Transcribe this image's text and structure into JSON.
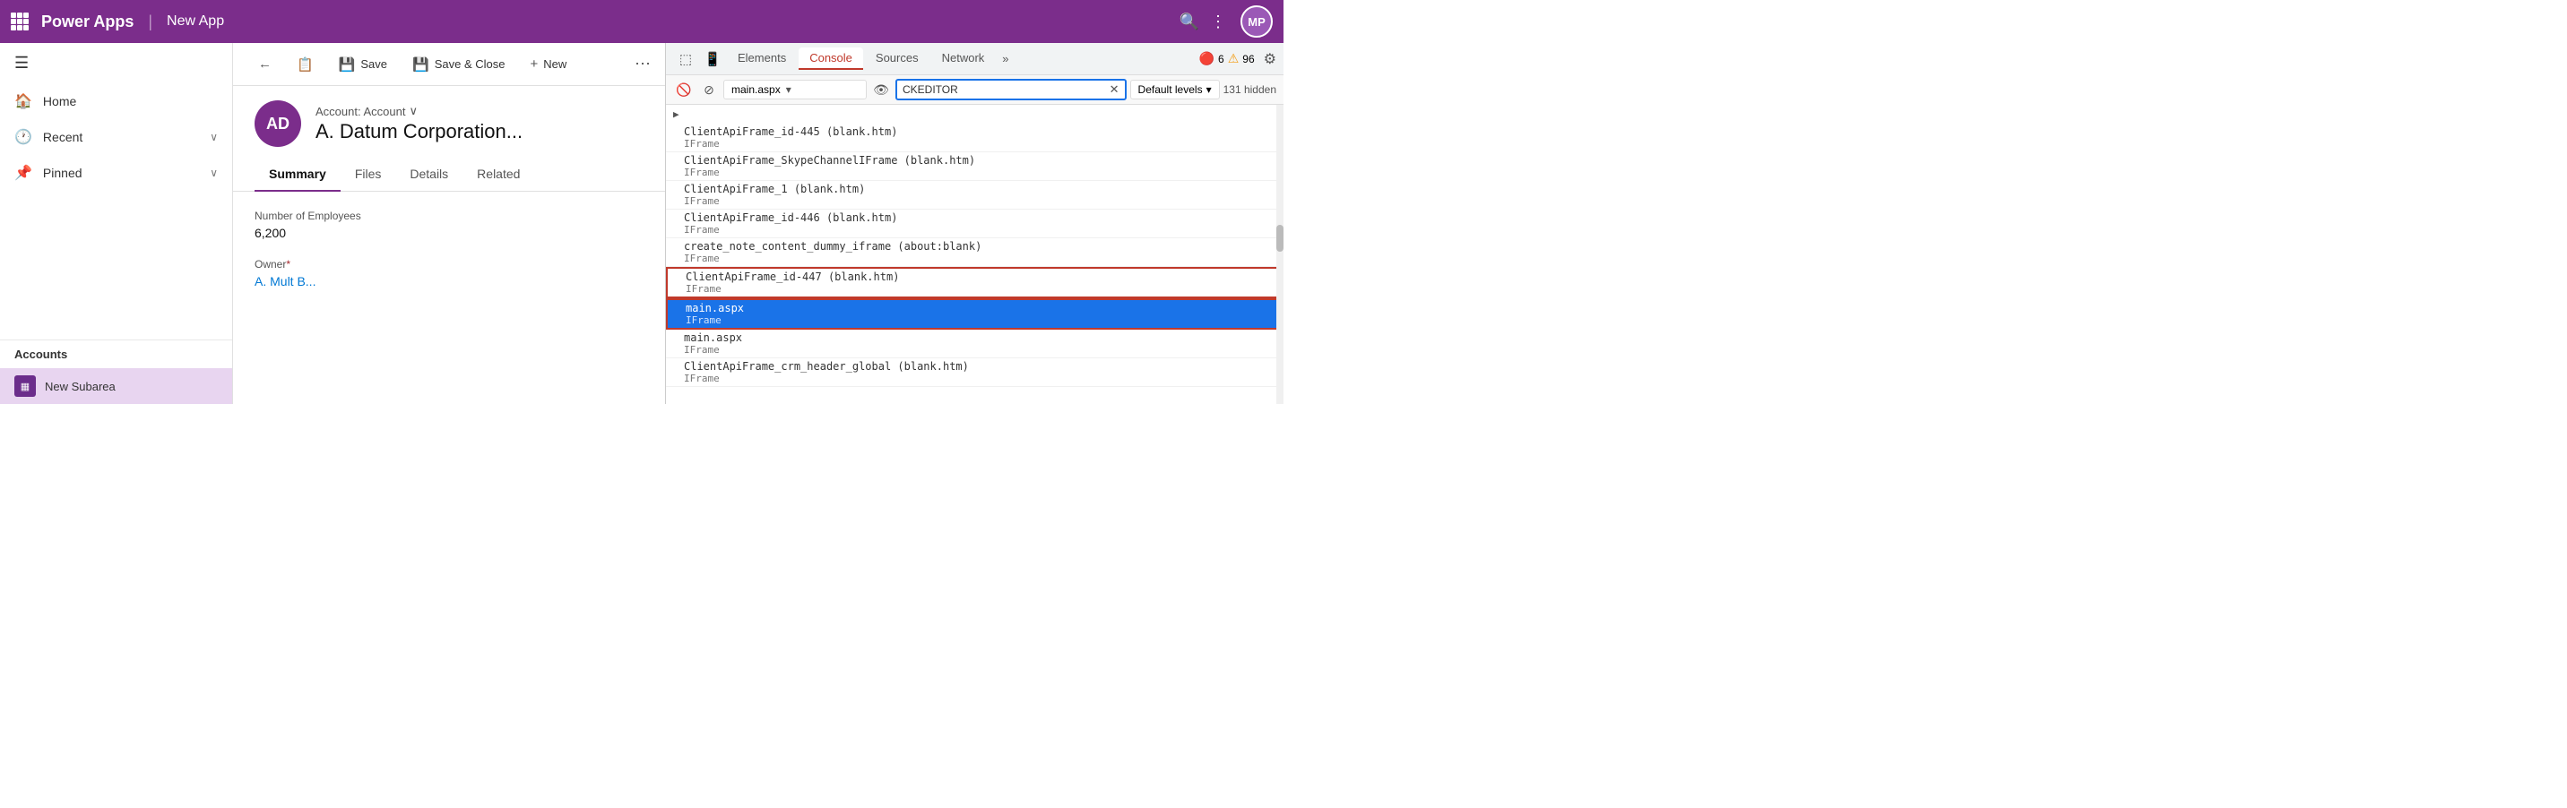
{
  "topbar": {
    "app_icon": "waffle",
    "title": "Power Apps",
    "divider": "|",
    "app_name": "New App",
    "search_icon": "🔍",
    "more_icon": "⋮",
    "avatar_initials": "MP"
  },
  "sidebar": {
    "toggle_icon": "☰",
    "nav_items": [
      {
        "id": "home",
        "icon": "🏠",
        "label": "Home",
        "has_chevron": false
      },
      {
        "id": "recent",
        "icon": "🕐",
        "label": "Recent",
        "has_chevron": true
      },
      {
        "id": "pinned",
        "icon": "📌",
        "label": "Pinned",
        "has_chevron": true
      }
    ],
    "section_label": "Accounts",
    "subarea_label": "New Subarea"
  },
  "commandbar": {
    "back_icon": "←",
    "form_icon": "📋",
    "save_label": "Save",
    "save_close_icon": "💾",
    "save_close_label": "Save & Close",
    "new_icon": "+",
    "new_label": "New",
    "more_icon": "⋯"
  },
  "record": {
    "avatar_initials": "AD",
    "type_label": "Account: Account",
    "chevron_icon": "∨",
    "name": "A. Datum Corporation...",
    "tabs": [
      {
        "id": "summary",
        "label": "Summary",
        "active": true
      },
      {
        "id": "files",
        "label": "Files",
        "active": false
      },
      {
        "id": "details",
        "label": "Details",
        "active": false
      },
      {
        "id": "related",
        "label": "Related",
        "active": false
      }
    ],
    "fields": [
      {
        "label": "Number of Employees",
        "value": "6,200",
        "required": false,
        "is_link": false
      },
      {
        "label": "Owner",
        "required": true,
        "value": "A. Mult B...",
        "is_link": true
      }
    ]
  },
  "devtools": {
    "tabs": [
      {
        "id": "elements",
        "label": "Elements",
        "active": false
      },
      {
        "id": "console",
        "label": "Console",
        "active": true
      },
      {
        "id": "sources",
        "label": "Sources",
        "active": false
      },
      {
        "id": "network",
        "label": "Network",
        "active": false
      }
    ],
    "more_label": "»",
    "error_count": "6",
    "warn_count": "96",
    "settings_icon": "⚙",
    "toolbar": {
      "clear_icon": "🚫",
      "stop_icon": "⊘",
      "context": "main.aspx",
      "eye_icon": "👁",
      "filter_value": "CKEDITOR",
      "filter_clear": "✕",
      "level_label": "Default levels",
      "level_chevron": "▾",
      "hidden_count": "131 hidden"
    },
    "console_items": [
      {
        "id": 1,
        "main": "ClientApiFrame_id-445 (blank.htm)",
        "sub": "IFrame",
        "selected": false,
        "highlighted": false,
        "has_arrow": false
      },
      {
        "id": 2,
        "main": "ClientApiFrame_SkypeChannelIFrame (blank.htm)",
        "sub": "IFrame",
        "selected": false,
        "highlighted": false,
        "has_arrow": false
      },
      {
        "id": 3,
        "main": "ClientApiFrame_1 (blank.htm)",
        "sub": "IFrame",
        "selected": false,
        "highlighted": false,
        "has_arrow": false
      },
      {
        "id": 4,
        "main": "ClientApiFrame_id-446 (blank.htm)",
        "sub": "IFrame",
        "selected": false,
        "highlighted": false,
        "has_arrow": false
      },
      {
        "id": 5,
        "main": "create_note_content_dummy_iframe (about:blank)",
        "sub": "IFrame",
        "selected": false,
        "highlighted": false,
        "has_arrow": false
      },
      {
        "id": 6,
        "main": "ClientApiFrame_id-447 (blank.htm)",
        "sub": "IFrame",
        "selected": false,
        "highlighted": true,
        "has_arrow": false
      },
      {
        "id": 7,
        "main": "main.aspx",
        "sub": "IFrame",
        "selected": true,
        "highlighted": true,
        "has_arrow": false
      },
      {
        "id": 8,
        "main": "main.aspx",
        "sub": "IFrame",
        "selected": false,
        "highlighted": false,
        "has_arrow": false
      },
      {
        "id": 9,
        "main": "ClientApiFrame_crm_header_global (blank.htm)",
        "sub": "IFrame",
        "selected": false,
        "highlighted": false,
        "has_arrow": false
      }
    ],
    "expand_arrow": "▶"
  }
}
